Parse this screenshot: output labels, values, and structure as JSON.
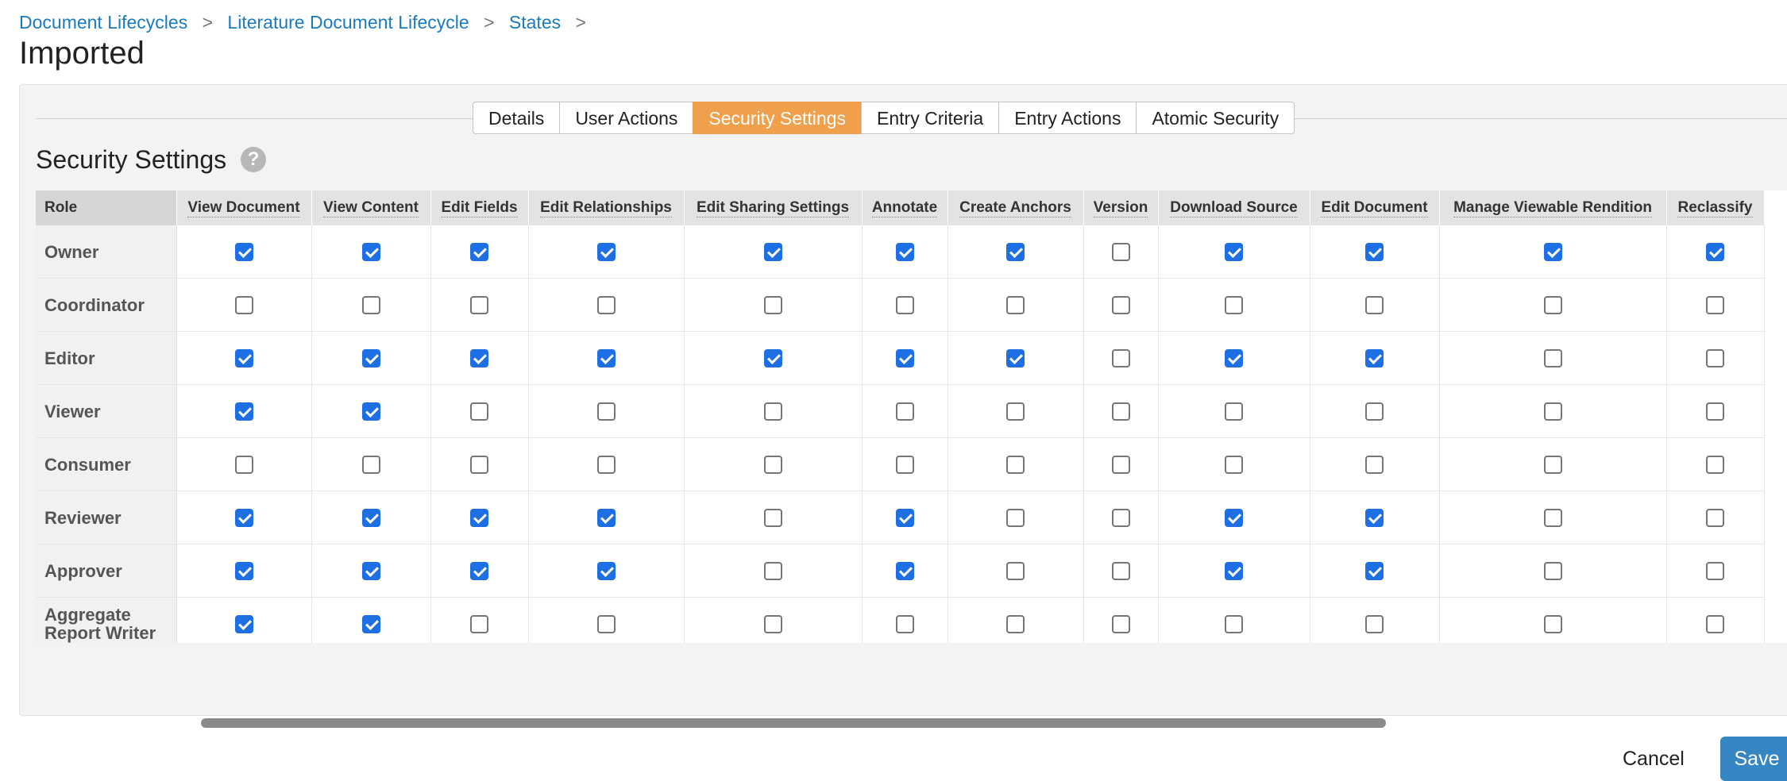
{
  "breadcrumb": {
    "items": [
      "Document Lifecycles",
      "Literature Document Lifecycle",
      "States"
    ],
    "separator": ">"
  },
  "page_title": "Imported",
  "tabs": [
    "Details",
    "User Actions",
    "Security Settings",
    "Entry Criteria",
    "Entry Actions",
    "Atomic Security"
  ],
  "active_tab": "Security Settings",
  "section": {
    "title": "Security Settings",
    "help_icon": "?"
  },
  "table": {
    "role_header": "Role",
    "columns": [
      "View Document",
      "View Content",
      "Edit Fields",
      "Edit Relationships",
      "Edit Sharing Settings",
      "Annotate",
      "Create Anchors",
      "Version",
      "Download Source",
      "Edit Document",
      "Manage Viewable Rendition",
      "Reclassify"
    ],
    "rows": [
      {
        "role": "Owner",
        "checked": [
          true,
          true,
          true,
          true,
          true,
          true,
          true,
          false,
          true,
          true,
          true,
          true
        ]
      },
      {
        "role": "Coordinator",
        "checked": [
          false,
          false,
          false,
          false,
          false,
          false,
          false,
          false,
          false,
          false,
          false,
          false
        ]
      },
      {
        "role": "Editor",
        "checked": [
          true,
          true,
          true,
          true,
          true,
          true,
          true,
          false,
          true,
          true,
          false,
          false
        ]
      },
      {
        "role": "Viewer",
        "checked": [
          true,
          true,
          false,
          false,
          false,
          false,
          false,
          false,
          false,
          false,
          false,
          false
        ]
      },
      {
        "role": "Consumer",
        "checked": [
          false,
          false,
          false,
          false,
          false,
          false,
          false,
          false,
          false,
          false,
          false,
          false
        ]
      },
      {
        "role": "Reviewer",
        "checked": [
          true,
          true,
          true,
          true,
          false,
          true,
          false,
          false,
          true,
          true,
          false,
          false
        ]
      },
      {
        "role": "Approver",
        "checked": [
          true,
          true,
          true,
          true,
          false,
          true,
          false,
          false,
          true,
          true,
          false,
          false
        ]
      },
      {
        "role": "Aggregate Report Writer",
        "checked": [
          true,
          true,
          false,
          false,
          false,
          false,
          false,
          false,
          false,
          false,
          false,
          false
        ]
      }
    ]
  },
  "buttons": {
    "cancel": "Cancel",
    "save": "Save"
  },
  "colors": {
    "active_tab": "#f0a04b",
    "link": "#1a7bbf",
    "checkbox_checked": "#1f6fe4",
    "save_button": "#3686c4"
  }
}
